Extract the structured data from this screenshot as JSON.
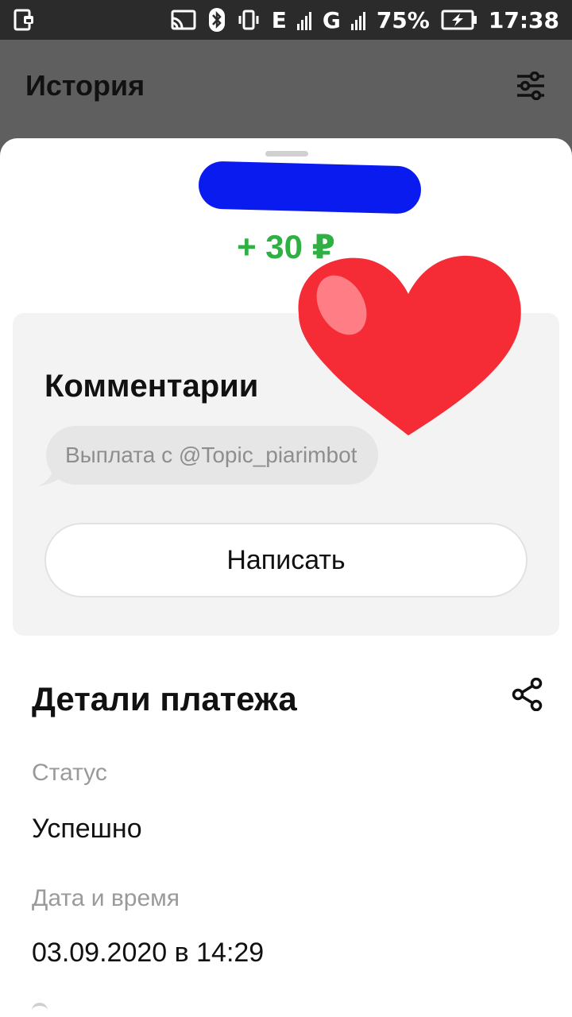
{
  "status_bar": {
    "network": "E",
    "network2": "G",
    "battery": "75%",
    "time": "17:38",
    "icons": [
      "sim-lock-icon",
      "cast-icon",
      "bluetooth-icon",
      "vibrate-icon",
      "signal-icon",
      "battery-charging-icon"
    ]
  },
  "appbar": {
    "title": "История",
    "filter_icon": "sliders-icon"
  },
  "transaction": {
    "amount": "+ 30 ₽",
    "amount_color": "#2eb043"
  },
  "comments": {
    "title": "Комментарии",
    "message": "Выплата с @Topic_piarimbot",
    "write_button": "Написать"
  },
  "details": {
    "title": "Детали платежа",
    "share_icon": "share-icon",
    "fields": [
      {
        "label": "Статус",
        "value": "Успешно"
      },
      {
        "label": "Дата и время",
        "value": "03.09.2020 в 14:29"
      }
    ]
  },
  "colors": {
    "appbar_bg": "#5f5f5f",
    "statusbar_bg": "#2b2b2b",
    "redaction": "#0a1bf0",
    "heart": "#f52b36"
  }
}
